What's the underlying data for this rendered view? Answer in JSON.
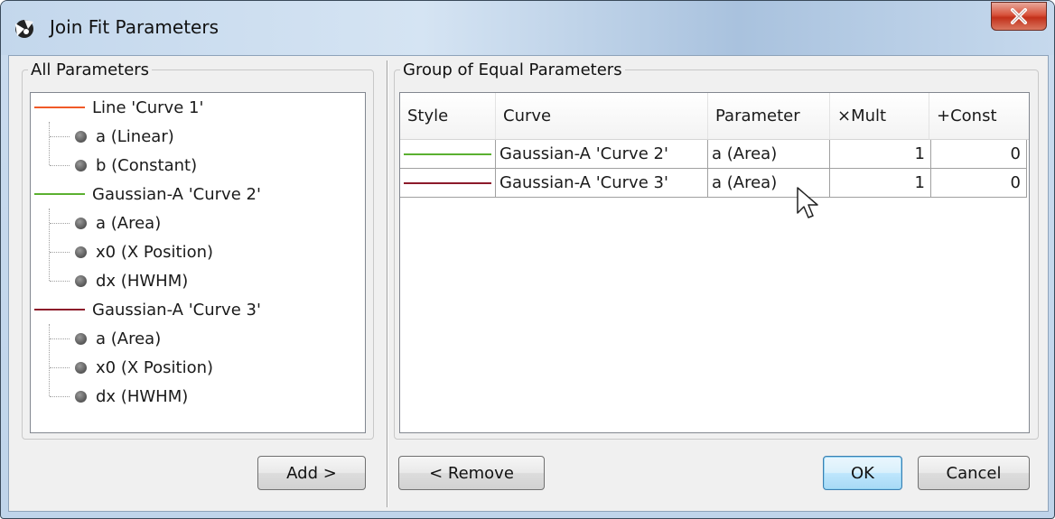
{
  "window": {
    "title": "Join Fit Parameters"
  },
  "all_parameters": {
    "label": "All Parameters",
    "curves": [
      {
        "label": "Line 'Curve 1'",
        "color": "#f05a28",
        "params": [
          "a (Linear)",
          "b (Constant)"
        ]
      },
      {
        "label": "Gaussian-A 'Curve 2'",
        "color": "#5bb030",
        "params": [
          "a (Area)",
          "x0 (X Position)",
          "dx (HWHM)"
        ]
      },
      {
        "label": "Gaussian-A 'Curve 3'",
        "color": "#8c1a2a",
        "params": [
          "a (Area)",
          "x0 (X Position)",
          "dx (HWHM)"
        ]
      }
    ],
    "add_button": "Add >"
  },
  "equal_group": {
    "label": "Group of Equal Parameters",
    "columns": [
      "Style",
      "Curve",
      "Parameter",
      "×Mult",
      "+Const"
    ],
    "rows": [
      {
        "style_color": "#5bb030",
        "curve": "Gaussian-A 'Curve 2'",
        "parameter": "a (Area)",
        "mult": "1",
        "const": "0"
      },
      {
        "style_color": "#8c1a2a",
        "curve": "Gaussian-A 'Curve 3'",
        "parameter": "a (Area)",
        "mult": "1",
        "const": "0"
      }
    ],
    "remove_button": "< Remove"
  },
  "dialog_buttons": {
    "ok": "OK",
    "cancel": "Cancel"
  }
}
